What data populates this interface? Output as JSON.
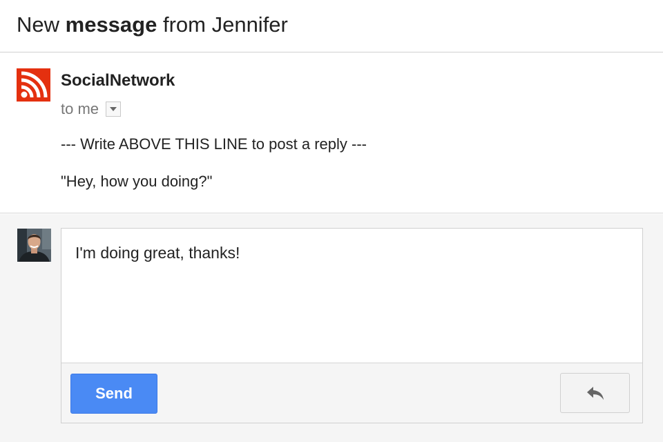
{
  "subject": {
    "prefix": "New ",
    "emphasis": "message",
    "suffix": " from Jennifer"
  },
  "message": {
    "sender_name": "SocialNetwork",
    "sender_logo_icon": "rss-feed-icon",
    "recipient_label": "to me",
    "body_lines": [
      "--- Write ABOVE THIS LINE to post a reply ---",
      "\"Hey, how you doing?\""
    ]
  },
  "reply": {
    "avatar_icon": "user-avatar",
    "compose_text": "I'm doing great, thanks!",
    "send_label": "Send",
    "reply_icon": "reply-arrow-icon"
  },
  "colors": {
    "accent": "#4a8af4",
    "logo": "#e4300f",
    "background": "#f5f5f5"
  }
}
